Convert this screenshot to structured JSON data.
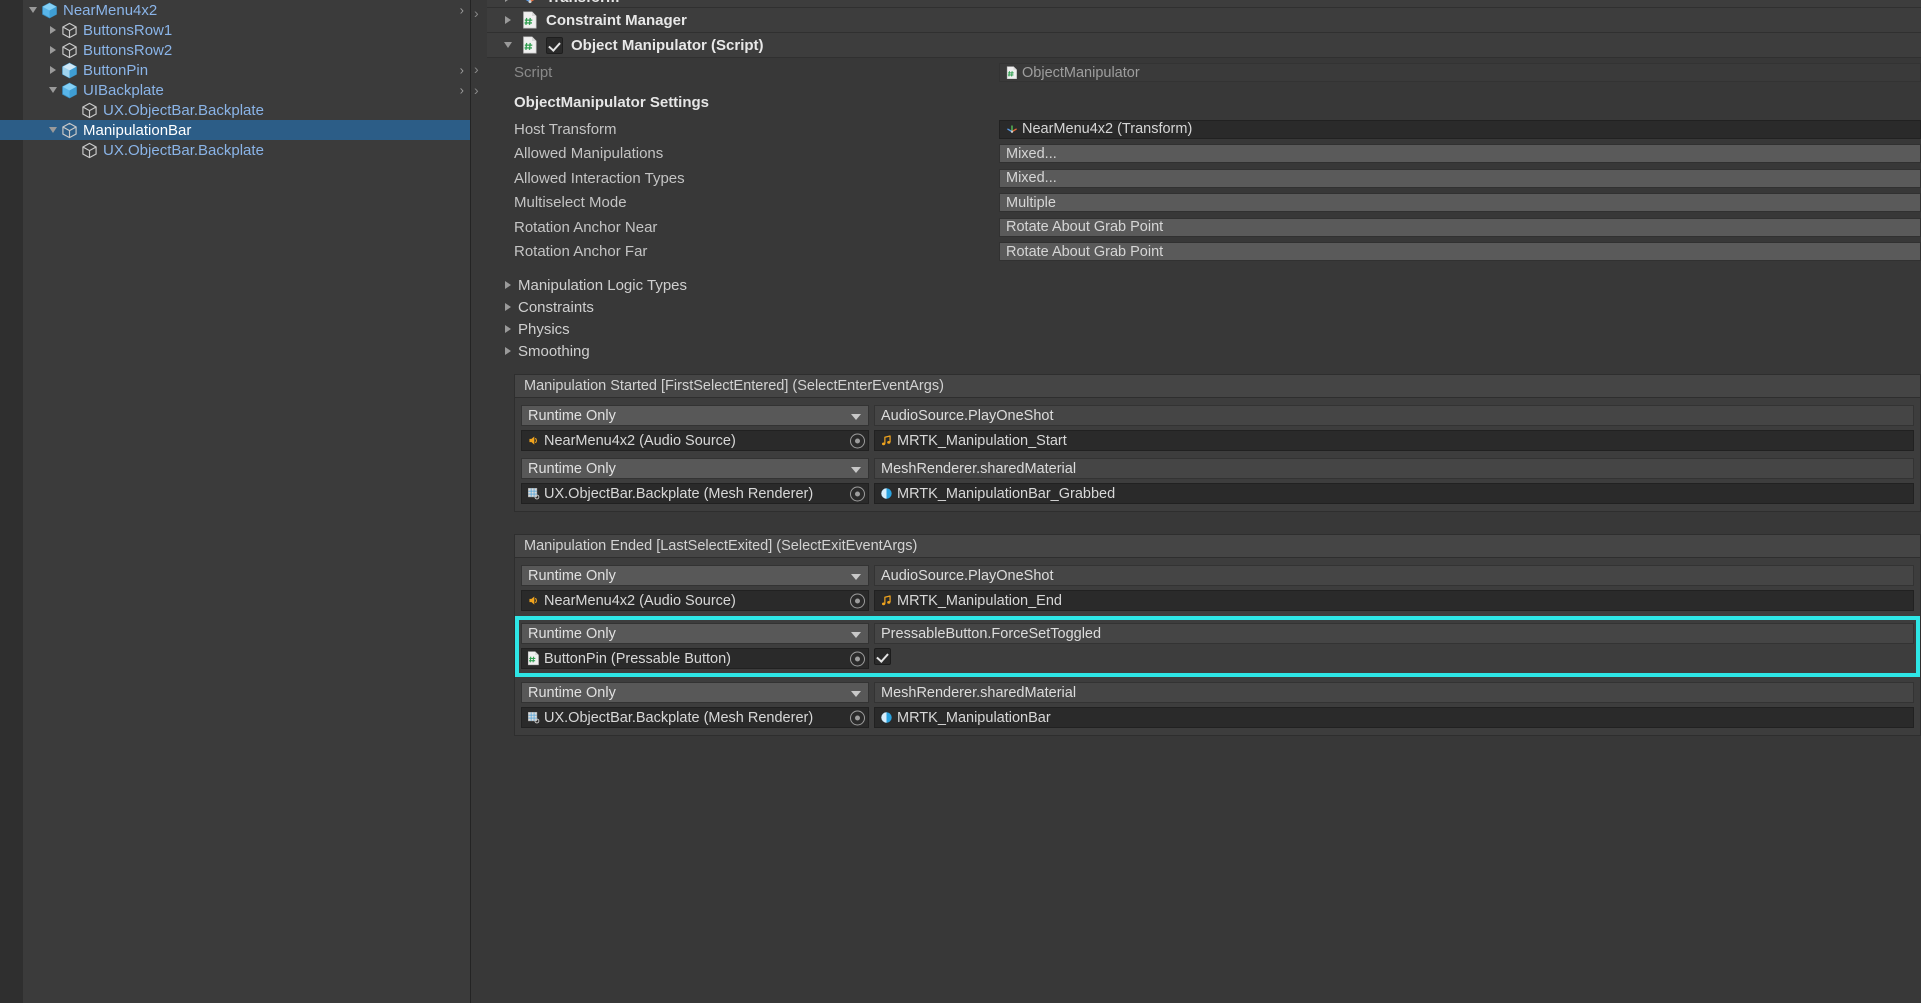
{
  "theme": {
    "bg": "#383838",
    "panel": "#3b3b3b",
    "selection": "#2c5d87",
    "link_text": "#8ab4e8",
    "highlight": "#2ee6e6"
  },
  "hierarchy": {
    "items": [
      {
        "label": "NearMenu4x2",
        "indent": 1,
        "twisty": "open",
        "icon": "prefab-cube-icon",
        "selected": false,
        "overflow_arrow": true
      },
      {
        "label": "ButtonsRow1",
        "indent": 2,
        "twisty": "closed",
        "icon": "gameobject-cube-icon",
        "selected": false,
        "overflow_arrow": false
      },
      {
        "label": "ButtonsRow2",
        "indent": 2,
        "twisty": "closed",
        "icon": "gameobject-cube-icon",
        "selected": false,
        "overflow_arrow": false
      },
      {
        "label": "ButtonPin",
        "indent": 2,
        "twisty": "closed",
        "icon": "prefab-variant-cube-icon",
        "selected": false,
        "overflow_arrow": true
      },
      {
        "label": "UIBackplate",
        "indent": 2,
        "twisty": "open",
        "icon": "prefab-cube-icon",
        "selected": false,
        "overflow_arrow": true
      },
      {
        "label": "UX.ObjectBar.Backplate",
        "indent": 3,
        "twisty": "none",
        "icon": "gameobject-cube-icon",
        "selected": false,
        "overflow_arrow": false
      },
      {
        "label": "ManipulationBar",
        "indent": 2,
        "twisty": "open",
        "icon": "gameobject-cube-icon",
        "selected": true,
        "overflow_arrow": false
      },
      {
        "label": "UX.ObjectBar.Backplate",
        "indent": 3,
        "twisty": "none",
        "icon": "gameobject-cube-icon",
        "selected": false,
        "overflow_arrow": false
      }
    ]
  },
  "inspector": {
    "components": [
      {
        "title": "Transform",
        "icon": "transform-axis-icon",
        "expanded": false,
        "has_checkbox": false
      },
      {
        "title": "Constraint Manager",
        "icon": "script-hash-icon",
        "expanded": false,
        "has_checkbox": false
      },
      {
        "title": "Object Manipulator (Script)",
        "icon": "script-hash-icon",
        "expanded": true,
        "has_checkbox": true,
        "checked": true
      }
    ],
    "script_row": {
      "label": "Script",
      "value": "ObjectManipulator",
      "icon": "script-hash-icon"
    },
    "section_header": "ObjectManipulator Settings",
    "properties": [
      {
        "label": "Host Transform",
        "value": "NearMenu4x2 (Transform)",
        "kind": "object",
        "icon": "transform-axis-icon"
      },
      {
        "label": "Allowed Manipulations",
        "value": "Mixed...",
        "kind": "enum",
        "icon": ""
      },
      {
        "label": "Allowed Interaction Types",
        "value": "Mixed...",
        "kind": "enum",
        "icon": ""
      },
      {
        "label": "Multiselect Mode",
        "value": "Multiple",
        "kind": "enum",
        "icon": ""
      },
      {
        "label": "Rotation Anchor Near",
        "value": "Rotate About Grab Point",
        "kind": "enum",
        "icon": ""
      },
      {
        "label": "Rotation Anchor Far",
        "value": "Rotate About Grab Point",
        "kind": "enum",
        "icon": ""
      }
    ],
    "foldouts": [
      {
        "label": "Manipulation Logic Types",
        "expanded": false
      },
      {
        "label": "Constraints",
        "expanded": false
      },
      {
        "label": "Physics",
        "expanded": false
      },
      {
        "label": "Smoothing",
        "expanded": false
      }
    ],
    "event_blocks": [
      {
        "title": "Manipulation Started [FirstSelectEntered] (SelectEnterEventArgs)",
        "entries": [
          {
            "mode": "Runtime Only",
            "target": "NearMenu4x2 (Audio Source)",
            "target_icon": "audiosource-icon",
            "method": "AudioSource.PlayOneShot",
            "argument": "MRTK_Manipulation_Start",
            "argument_icon": "audioclip-icon",
            "argument_kind": "object",
            "highlighted": false
          },
          {
            "mode": "Runtime Only",
            "target": "UX.ObjectBar.Backplate (Mesh Renderer)",
            "target_icon": "meshrenderer-icon",
            "method": "MeshRenderer.sharedMaterial",
            "argument": "MRTK_ManipulationBar_Grabbed",
            "argument_icon": "material-icon",
            "argument_kind": "object",
            "highlighted": false
          }
        ]
      },
      {
        "title": "Manipulation Ended [LastSelectExited] (SelectExitEventArgs)",
        "entries": [
          {
            "mode": "Runtime Only",
            "target": "NearMenu4x2 (Audio Source)",
            "target_icon": "audiosource-icon",
            "method": "AudioSource.PlayOneShot",
            "argument": "MRTK_Manipulation_End",
            "argument_icon": "audioclip-icon",
            "argument_kind": "object",
            "highlighted": false
          },
          {
            "mode": "Runtime Only",
            "target": "ButtonPin (Pressable Button)",
            "target_icon": "script-hash-icon",
            "method": "PressableButton.ForceSetToggled",
            "argument": "",
            "argument_icon": "",
            "argument_kind": "boolean",
            "argument_checked": true,
            "highlighted": true
          },
          {
            "mode": "Runtime Only",
            "target": "UX.ObjectBar.Backplate (Mesh Renderer)",
            "target_icon": "meshrenderer-icon",
            "method": "MeshRenderer.sharedMaterial",
            "argument": "MRTK_ManipulationBar",
            "argument_icon": "material-icon",
            "argument_kind": "object",
            "highlighted": false
          }
        ]
      }
    ]
  }
}
